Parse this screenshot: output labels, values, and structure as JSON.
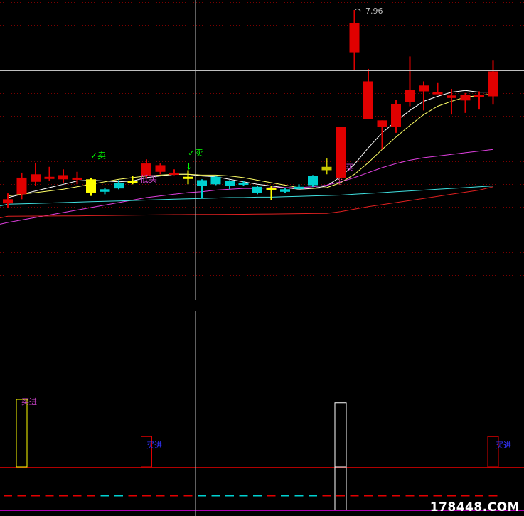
{
  "colors": {
    "up": "#e00000",
    "down": "#00d0d0",
    "neutral": "#ffff00",
    "highlight": "#c8c800",
    "ma_white": "#ffffff",
    "ma_yellow": "#ffff66",
    "ma_magenta": "#e040e0",
    "ma_cyan": "#40e0e0",
    "ma_red": "#e02020",
    "sell_signal": "#00ff00",
    "buy_signal": "#cc44cc",
    "sub_label": "#3333ff",
    "crosshair": "#c0c0c0",
    "grid": "#7a0000"
  },
  "chart_data": [
    {
      "type": "candlestick",
      "grid": true,
      "annotations": {
        "high_label": "7.96",
        "sell_1": "✓卖",
        "sell_2": "✓卖",
        "low_buy": "低买",
        "buy": "买"
      },
      "candles": [
        {
          "o": 5.68,
          "h": 5.75,
          "l": 5.58,
          "c": 5.63,
          "color": "up"
        },
        {
          "o": 5.74,
          "h": 6.0,
          "l": 5.68,
          "c": 5.94,
          "color": "up"
        },
        {
          "o": 5.89,
          "h": 6.12,
          "l": 5.84,
          "c": 5.98,
          "color": "up"
        },
        {
          "o": 5.95,
          "h": 6.07,
          "l": 5.9,
          "c": 5.95,
          "color": "up"
        },
        {
          "o": 5.92,
          "h": 6.04,
          "l": 5.88,
          "c": 5.97,
          "color": "up"
        },
        {
          "o": 5.93,
          "h": 6.01,
          "l": 5.86,
          "c": 5.94,
          "color": "up"
        },
        {
          "o": 5.92,
          "h": 5.94,
          "l": 5.72,
          "c": 5.76,
          "color": "neutral"
        },
        {
          "o": 5.77,
          "h": 5.82,
          "l": 5.74,
          "c": 5.8,
          "color": "down"
        },
        {
          "o": 5.81,
          "h": 5.91,
          "l": 5.8,
          "c": 5.88,
          "color": "down"
        },
        {
          "o": 5.9,
          "h": 5.96,
          "l": 5.86,
          "c": 5.9,
          "color": "neutral"
        },
        {
          "o": 5.96,
          "h": 6.16,
          "l": 5.94,
          "c": 6.11,
          "color": "up"
        },
        {
          "o": 6.09,
          "h": 6.11,
          "l": 5.98,
          "c": 6.01,
          "color": "up"
        },
        {
          "o": 6.0,
          "h": 6.04,
          "l": 5.97,
          "c": 6.0,
          "color": "up"
        },
        {
          "o": 5.95,
          "h": 6.03,
          "l": 5.86,
          "c": 5.95,
          "color": "neutral"
        },
        {
          "o": 5.91,
          "h": 5.92,
          "l": 5.69,
          "c": 5.84,
          "color": "down"
        },
        {
          "o": 5.95,
          "h": 5.96,
          "l": 5.85,
          "c": 5.86,
          "color": "down"
        },
        {
          "o": 5.9,
          "h": 5.91,
          "l": 5.8,
          "c": 5.84,
          "color": "down"
        },
        {
          "o": 5.88,
          "h": 5.9,
          "l": 5.84,
          "c": 5.86,
          "color": "down"
        },
        {
          "o": 5.83,
          "h": 5.84,
          "l": 5.74,
          "c": 5.76,
          "color": "down"
        },
        {
          "o": 5.82,
          "h": 5.84,
          "l": 5.67,
          "c": 5.8,
          "color": "neutral"
        },
        {
          "o": 5.8,
          "h": 5.82,
          "l": 5.76,
          "c": 5.77,
          "color": "down"
        },
        {
          "o": 5.83,
          "h": 5.86,
          "l": 5.8,
          "c": 5.81,
          "color": "down"
        },
        {
          "o": 5.96,
          "h": 5.97,
          "l": 5.83,
          "c": 5.85,
          "color": "down"
        },
        {
          "o": 6.03,
          "h": 6.17,
          "l": 5.98,
          "c": 6.07,
          "color": "highlight"
        },
        {
          "o": 5.94,
          "h": 6.55,
          "l": 5.94,
          "c": 6.55,
          "color": "up"
        },
        {
          "o": 7.45,
          "h": 7.96,
          "l": 7.23,
          "c": 7.8,
          "color": "up"
        },
        {
          "o": 7.1,
          "h": 7.25,
          "l": 6.65,
          "c": 6.65,
          "color": "up"
        },
        {
          "o": 6.63,
          "h": 6.63,
          "l": 6.28,
          "c": 6.55,
          "color": "up"
        },
        {
          "o": 6.55,
          "h": 6.88,
          "l": 6.48,
          "c": 6.83,
          "color": "up"
        },
        {
          "o": 7.0,
          "h": 7.4,
          "l": 6.8,
          "c": 6.85,
          "color": "up"
        },
        {
          "o": 6.98,
          "h": 7.1,
          "l": 6.75,
          "c": 7.05,
          "color": "up"
        },
        {
          "o": 6.97,
          "h": 7.08,
          "l": 6.95,
          "c": 6.97,
          "color": "up"
        },
        {
          "o": 6.93,
          "h": 7.01,
          "l": 6.7,
          "c": 6.9,
          "color": "up"
        },
        {
          "o": 6.94,
          "h": 6.96,
          "l": 6.72,
          "c": 6.87,
          "color": "up"
        },
        {
          "o": 6.94,
          "h": 6.98,
          "l": 6.76,
          "c": 6.92,
          "color": "up"
        },
        {
          "o": 6.92,
          "h": 7.35,
          "l": 6.82,
          "c": 7.22,
          "color": "up"
        }
      ],
      "ma_lines": [
        {
          "color": "ma_white",
          "values": [
            5.7,
            5.74,
            5.78,
            5.82,
            5.86,
            5.9,
            5.91,
            5.9,
            5.89,
            5.9,
            5.94,
            5.96,
            5.98,
            5.98,
            5.96,
            5.95,
            5.92,
            5.89,
            5.86,
            5.84,
            5.82,
            5.8,
            5.81,
            5.84,
            5.95,
            6.1,
            6.3,
            6.48,
            6.62,
            6.75,
            6.86,
            6.92,
            6.97,
            6.99,
            6.97,
            6.97
          ]
        },
        {
          "color": "ma_yellow",
          "values": [
            5.72,
            5.74,
            5.76,
            5.78,
            5.8,
            5.83,
            5.86,
            5.89,
            5.92,
            5.94,
            5.96,
            5.97,
            5.98,
            5.98,
            5.97,
            5.97,
            5.96,
            5.94,
            5.91,
            5.88,
            5.85,
            5.82,
            5.81,
            5.82,
            5.88,
            5.98,
            6.12,
            6.28,
            6.43,
            6.57,
            6.7,
            6.8,
            6.86,
            6.91,
            6.93,
            6.95
          ]
        },
        {
          "color": "ma_magenta",
          "values": [
            5.4,
            5.43,
            5.46,
            5.49,
            5.52,
            5.55,
            5.58,
            5.61,
            5.64,
            5.67,
            5.7,
            5.72,
            5.74,
            5.76,
            5.77,
            5.79,
            5.8,
            5.81,
            5.81,
            5.82,
            5.82,
            5.82,
            5.83,
            5.85,
            5.89,
            5.94,
            6.0,
            6.06,
            6.11,
            6.15,
            6.18,
            6.2,
            6.22,
            6.24,
            6.26,
            6.28
          ]
        },
        {
          "color": "ma_cyan",
          "values": [
            5.62,
            5.625,
            5.63,
            5.635,
            5.64,
            5.645,
            5.65,
            5.655,
            5.66,
            5.665,
            5.67,
            5.675,
            5.68,
            5.685,
            5.69,
            5.695,
            5.7,
            5.7,
            5.705,
            5.705,
            5.71,
            5.715,
            5.72,
            5.725,
            5.73,
            5.74,
            5.75,
            5.76,
            5.77,
            5.78,
            5.79,
            5.8,
            5.81,
            5.82,
            5.83,
            5.84
          ]
        },
        {
          "color": "ma_red",
          "values": [
            5.475,
            5.476,
            5.477,
            5.478,
            5.479,
            5.48,
            5.482,
            5.484,
            5.486,
            5.488,
            5.49,
            5.492,
            5.494,
            5.495,
            5.496,
            5.497,
            5.498,
            5.499,
            5.5,
            5.502,
            5.504,
            5.506,
            5.508,
            5.51,
            5.53,
            5.56,
            5.59,
            5.615,
            5.64,
            5.665,
            5.69,
            5.715,
            5.74,
            5.765,
            5.79,
            5.83
          ]
        }
      ]
    },
    {
      "type": "bar",
      "grid": true,
      "annotations": {
        "signal_1": "买进",
        "signal_2": "买进",
        "signal_3": "买进"
      },
      "signals": [
        {
          "index": 1,
          "value": 1.0,
          "color": "neutral"
        },
        {
          "index": 10,
          "value": 0.45,
          "color": "up"
        },
        {
          "index": 24,
          "value": 0.95,
          "color": "ma_white"
        },
        {
          "index": 35,
          "value": 0.45,
          "color": "up"
        }
      ]
    }
  ]
}
